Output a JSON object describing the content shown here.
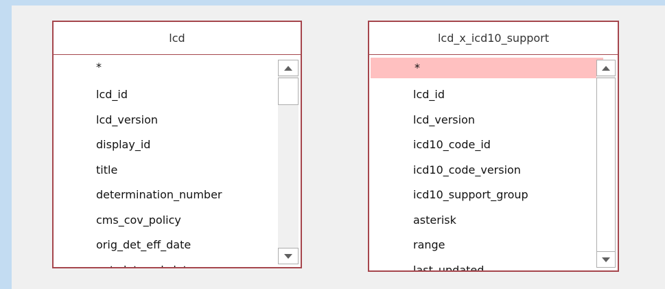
{
  "tables": [
    {
      "name": "lcd",
      "fields": [
        "*",
        "lcd_id",
        "lcd_version",
        "display_id",
        "title",
        "determination_number",
        "cms_cov_policy",
        "orig_det_eff_date",
        "ent_det_end_date"
      ]
    },
    {
      "name": "lcd_x_icd10_support",
      "fields": [
        "*",
        "lcd_id",
        "lcd_version",
        "icd10_code_id",
        "icd10_code_version",
        "icd10_support_group",
        "asterisk",
        "range",
        "last_updated"
      ],
      "selected_field": "*"
    }
  ],
  "colors": {
    "table_border": "#a5454c",
    "selection": "#ffc0c0",
    "canvas": "#f0f0f0",
    "window_frame": "#c3dcf2"
  },
  "icons": {
    "scroll_up": "triangle-up",
    "scroll_down": "triangle-down"
  }
}
